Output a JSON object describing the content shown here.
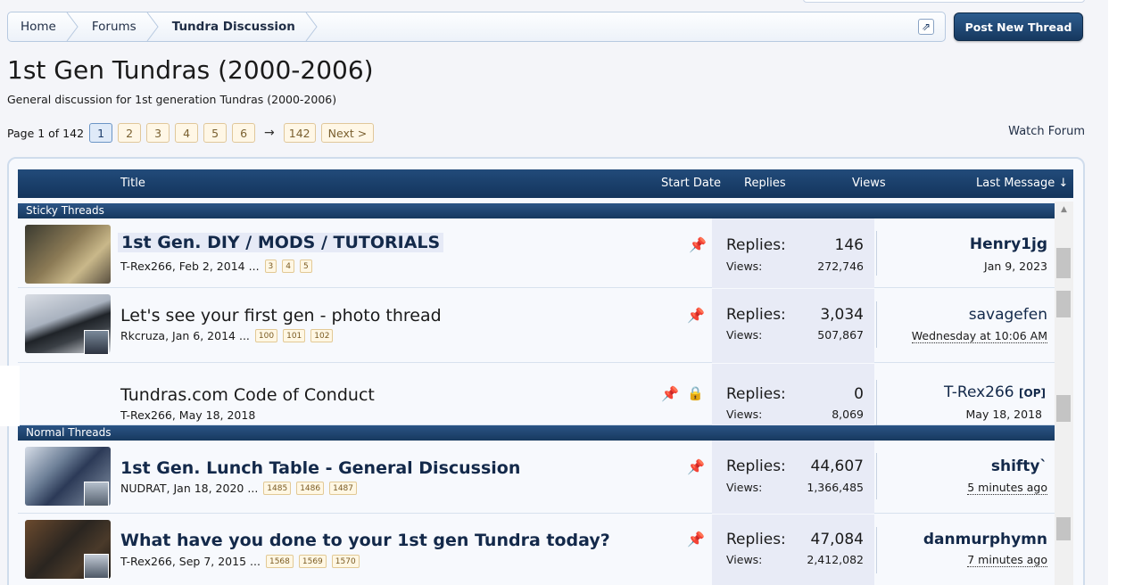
{
  "breadcrumb": {
    "items": [
      "Home",
      "Forums",
      "Tundra Discussion"
    ]
  },
  "post_button": "Post New Thread",
  "forum": {
    "title": "1st Gen Tundras (2000-2006)",
    "description": "General discussion for 1st generation Tundras (2000-2006)"
  },
  "pagination": {
    "label": "Page 1 of 142",
    "pages": [
      "1",
      "2",
      "3",
      "4",
      "5",
      "6"
    ],
    "arrow": "→",
    "last": "142",
    "next": "Next >"
  },
  "watch_forum": "Watch Forum",
  "columns": {
    "title": "Title",
    "start_date": "Start Date",
    "replies": "Replies",
    "views": "Views",
    "last_message": "Last Message ↓"
  },
  "sections": {
    "sticky": "Sticky Threads",
    "normal": "Normal Threads"
  },
  "stat_labels": {
    "replies": "Replies:",
    "views": "Views:"
  },
  "threads": [
    {
      "title": "1st Gen. DIY / MODS / TUTORIALS",
      "author_date": "T-Rex266, Feb 2, 2014",
      "ellipsis": "...",
      "pages": [
        "3",
        "4",
        "5"
      ],
      "replies": "146",
      "views": "272,746",
      "last_user": "Henry1jg",
      "last_date": "Jan 9, 2023"
    },
    {
      "title": "Let's see your first gen - photo thread",
      "author_date": "Rkcruza, Jan 6, 2014",
      "ellipsis": "...",
      "pages": [
        "100",
        "101",
        "102"
      ],
      "replies": "3,034",
      "views": "507,867",
      "last_user": "savagefen",
      "last_date": "Wednesday at 10:06 AM"
    },
    {
      "title": "Tundras.com Code of Conduct",
      "author_date": "T-Rex266, May 18, 2018",
      "ellipsis": "",
      "pages": [],
      "replies": "0",
      "views": "8,069",
      "last_user": "T-Rex266",
      "op_tag": "[OP]",
      "last_date": "May 18, 2018"
    },
    {
      "title": "1st Gen. Lunch Table - General Discussion",
      "author_date": "NUDRAT, Jan 18, 2020",
      "ellipsis": "...",
      "pages": [
        "1485",
        "1486",
        "1487"
      ],
      "replies": "44,607",
      "views": "1,366,485",
      "last_user": "shifty`",
      "last_date": "5 minutes ago"
    },
    {
      "title": "What have you done to your 1st gen Tundra today?",
      "author_date": "T-Rex266, Sep 7, 2015",
      "ellipsis": "...",
      "pages": [
        "1568",
        "1569",
        "1570"
      ],
      "replies": "47,084",
      "views": "2,412,082",
      "last_user": "danmurphymn",
      "last_date": "7 minutes ago"
    }
  ]
}
